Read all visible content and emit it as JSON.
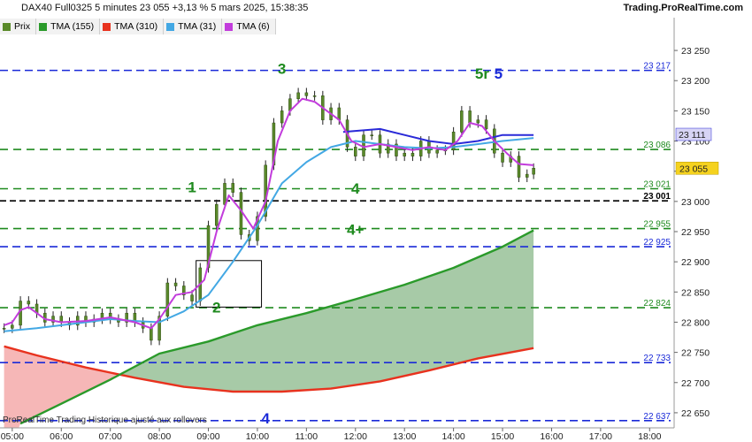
{
  "header": {
    "title": "DAX40 Full0325 5 minutes 23 055 +3,13 % 5 mars 2025, 15:38:35",
    "brand": "Trading.ProRealTime.com"
  },
  "legend": [
    {
      "label": "Prix",
      "color": "#5a8a2a"
    },
    {
      "label": "TMA (155)",
      "color": "#2a9a2a"
    },
    {
      "label": "TMA (310)",
      "color": "#e8321e"
    },
    {
      "label": "TMA (31)",
      "color": "#43a8e4"
    },
    {
      "label": "TMA (6)",
      "color": "#c23cdc"
    }
  ],
  "footer": "ProRealTime Trading  Historique ajusté aux rollovers",
  "chart_data": {
    "type": "line",
    "x_ticks": [
      "05:00",
      "06:00",
      "07:00",
      "08:00",
      "09:00",
      "10:00",
      "11:00",
      "12:00",
      "13:00",
      "14:00",
      "15:00",
      "16:00",
      "17:00",
      "18:00"
    ],
    "y_ticks": [
      22650,
      22700,
      22750,
      22800,
      22850,
      22900,
      22950,
      23000,
      23050,
      23100,
      23150,
      23200,
      23250
    ],
    "y_tick_labels": [
      "22 650",
      "22 700",
      "22 750",
      "22 800",
      "22 850",
      "22 900",
      "22 950",
      "23 000",
      "23 050",
      "23 100",
      "23 150",
      "23 200",
      "23 250"
    ],
    "ylim": [
      22625,
      23275
    ],
    "xlim": [
      "04:45",
      "18:30"
    ],
    "last_price": {
      "value": 23055,
      "label": "23 055",
      "color": "#f5d21e"
    },
    "levels": [
      {
        "value": 23217,
        "label": "23 217",
        "style": "dashed",
        "color": "#1a2ad8"
      },
      {
        "value": 23086,
        "label": "23 086",
        "style": "dashed",
        "color": "#1e8a1e"
      },
      {
        "value": 23021,
        "label": "23 021",
        "style": "dashed",
        "color": "#1e8a1e"
      },
      {
        "value": 23001,
        "label": "23 001",
        "style": "dashed",
        "color": "#000000"
      },
      {
        "value": 22955,
        "label": "22 955",
        "style": "dashed",
        "color": "#1e8a1e"
      },
      {
        "value": 22925,
        "label": "22 925",
        "style": "dashed",
        "color": "#1a2ad8"
      },
      {
        "value": 22824,
        "label": "22 824",
        "style": "dashed",
        "color": "#1e8a1e"
      },
      {
        "value": 22733,
        "label": "22 733",
        "style": "dashed",
        "color": "#1a2ad8"
      },
      {
        "value": 22637,
        "label": "22 637",
        "style": "dashed",
        "color": "#1a2ad8"
      }
    ],
    "tma31_tag": {
      "value": 23111,
      "label": "23 111"
    },
    "wave_labels": [
      {
        "text": "3",
        "time": "10:30",
        "value": 23220,
        "color": "#1e8a1e"
      },
      {
        "text": "5r",
        "time": "14:35",
        "value": 23212,
        "color": "#1e8a1e"
      },
      {
        "text": "5",
        "time": "14:55",
        "value": 23212,
        "color": "#1a2ad8"
      },
      {
        "text": "1",
        "time": "08:40",
        "value": 23024,
        "color": "#1e8a1e"
      },
      {
        "text": "4",
        "time": "12:00",
        "value": 23022,
        "color": "#1e8a1e"
      },
      {
        "text": "4+",
        "time": "12:00",
        "value": 22954,
        "color": "#1e8a1e"
      },
      {
        "text": "2",
        "time": "09:10",
        "value": 22825,
        "color": "#1e8a1e"
      },
      {
        "text": "4",
        "time": "10:10",
        "value": 22641,
        "color": "#1a2ad8"
      }
    ],
    "zone_box": {
      "t0": "08:45",
      "t1": "10:05",
      "v_top": 22902,
      "v_bottom": 22825
    },
    "series": [
      {
        "name": "Prix",
        "type": "candle-line",
        "color": "#5a8a2a",
        "points": [
          [
            "04:50",
            22790
          ],
          [
            "05:00",
            22795
          ],
          [
            "05:10",
            22835
          ],
          [
            "05:20",
            22830
          ],
          [
            "05:30",
            22815
          ],
          [
            "05:40",
            22800
          ],
          [
            "05:50",
            22810
          ],
          [
            "06:00",
            22800
          ],
          [
            "06:10",
            22795
          ],
          [
            "06:20",
            22810
          ],
          [
            "06:30",
            22800
          ],
          [
            "06:40",
            22805
          ],
          [
            "06:50",
            22815
          ],
          [
            "07:00",
            22805
          ],
          [
            "07:10",
            22800
          ],
          [
            "07:20",
            22815
          ],
          [
            "07:30",
            22800
          ],
          [
            "07:40",
            22790
          ],
          [
            "07:50",
            22770
          ],
          [
            "08:00",
            22810
          ],
          [
            "08:10",
            22865
          ],
          [
            "08:20",
            22860
          ],
          [
            "08:30",
            22845
          ],
          [
            "08:40",
            22835
          ],
          [
            "08:50",
            22890
          ],
          [
            "09:00",
            22960
          ],
          [
            "09:10",
            22995
          ],
          [
            "09:20",
            23030
          ],
          [
            "09:30",
            23015
          ],
          [
            "09:40",
            22945
          ],
          [
            "09:50",
            22935
          ],
          [
            "10:00",
            22975
          ],
          [
            "10:10",
            23060
          ],
          [
            "10:20",
            23130
          ],
          [
            "10:30",
            23150
          ],
          [
            "10:40",
            23170
          ],
          [
            "10:50",
            23180
          ],
          [
            "11:00",
            23175
          ],
          [
            "11:10",
            23175
          ],
          [
            "11:20",
            23135
          ],
          [
            "11:30",
            23155
          ],
          [
            "11:40",
            23135
          ],
          [
            "11:50",
            23090
          ],
          [
            "12:00",
            23075
          ],
          [
            "12:10",
            23110
          ],
          [
            "12:20",
            23110
          ],
          [
            "12:30",
            23080
          ],
          [
            "12:40",
            23095
          ],
          [
            "12:50",
            23075
          ],
          [
            "13:00",
            23080
          ],
          [
            "13:10",
            23075
          ],
          [
            "13:20",
            23100
          ],
          [
            "13:30",
            23080
          ],
          [
            "13:40",
            23085
          ],
          [
            "13:50",
            23085
          ],
          [
            "14:00",
            23115
          ],
          [
            "14:10",
            23150
          ],
          [
            "14:20",
            23130
          ],
          [
            "14:30",
            23135
          ],
          [
            "14:40",
            23120
          ],
          [
            "14:50",
            23080
          ],
          [
            "15:00",
            23065
          ],
          [
            "15:10",
            23075
          ],
          [
            "15:20",
            23040
          ],
          [
            "15:30",
            23045
          ],
          [
            "15:38",
            23055
          ]
        ]
      },
      {
        "name": "TMA (6)",
        "color": "#c23cdc",
        "points": [
          [
            "04:50",
            22795
          ],
          [
            "05:00",
            22800
          ],
          [
            "05:10",
            22820
          ],
          [
            "05:20",
            22825
          ],
          [
            "05:30",
            22815
          ],
          [
            "05:40",
            22805
          ],
          [
            "06:00",
            22800
          ],
          [
            "06:30",
            22802
          ],
          [
            "07:00",
            22808
          ],
          [
            "07:30",
            22800
          ],
          [
            "07:50",
            22790
          ],
          [
            "08:00",
            22805
          ],
          [
            "08:20",
            22845
          ],
          [
            "08:40",
            22850
          ],
          [
            "08:55",
            22870
          ],
          [
            "09:10",
            22950
          ],
          [
            "09:25",
            23010
          ],
          [
            "09:40",
            22985
          ],
          [
            "09:55",
            22955
          ],
          [
            "10:10",
            23000
          ],
          [
            "10:25",
            23100
          ],
          [
            "10:40",
            23150
          ],
          [
            "10:55",
            23170
          ],
          [
            "11:10",
            23165
          ],
          [
            "11:25",
            23150
          ],
          [
            "11:40",
            23135
          ],
          [
            "11:55",
            23100
          ],
          [
            "12:10",
            23090
          ],
          [
            "12:30",
            23095
          ],
          [
            "12:50",
            23090
          ],
          [
            "13:10",
            23085
          ],
          [
            "13:30",
            23090
          ],
          [
            "13:50",
            23085
          ],
          [
            "14:05",
            23100
          ],
          [
            "14:20",
            23130
          ],
          [
            "14:35",
            23125
          ],
          [
            "14:50",
            23100
          ],
          [
            "15:05",
            23080
          ],
          [
            "15:20",
            23062
          ],
          [
            "15:38",
            23060
          ]
        ]
      },
      {
        "name": "TMA (31)",
        "color": "#43a8e4",
        "points": [
          [
            "04:50",
            22785
          ],
          [
            "05:30",
            22790
          ],
          [
            "06:00",
            22795
          ],
          [
            "06:30",
            22800
          ],
          [
            "07:00",
            22805
          ],
          [
            "07:30",
            22802
          ],
          [
            "08:00",
            22800
          ],
          [
            "08:30",
            22818
          ],
          [
            "09:00",
            22845
          ],
          [
            "09:30",
            22900
          ],
          [
            "10:00",
            22960
          ],
          [
            "10:30",
            23030
          ],
          [
            "11:00",
            23065
          ],
          [
            "11:30",
            23090
          ],
          [
            "12:00",
            23100
          ],
          [
            "12:30",
            23095
          ],
          [
            "13:00",
            23090
          ],
          [
            "13:30",
            23088
          ],
          [
            "14:00",
            23090
          ],
          [
            "14:30",
            23095
          ],
          [
            "15:00",
            23100
          ],
          [
            "15:38",
            23105
          ]
        ]
      },
      {
        "name": "TMA (31) dark",
        "color": "#2a2ad8",
        "points": [
          [
            "11:45",
            23115
          ],
          [
            "12:30",
            23120
          ],
          [
            "13:00",
            23110
          ],
          [
            "13:30",
            23100
          ],
          [
            "14:00",
            23095
          ],
          [
            "14:30",
            23100
          ],
          [
            "15:00",
            23110
          ],
          [
            "15:38",
            23110
          ]
        ]
      },
      {
        "name": "TMA (155)",
        "color": "#2a9a2a",
        "points": [
          [
            "05:10",
            22632
          ],
          [
            "06:00",
            22665
          ],
          [
            "07:00",
            22705
          ],
          [
            "08:00",
            22748
          ],
          [
            "09:00",
            22768
          ],
          [
            "10:00",
            22795
          ],
          [
            "11:00",
            22815
          ],
          [
            "12:00",
            22838
          ],
          [
            "13:00",
            22862
          ],
          [
            "14:00",
            22890
          ],
          [
            "15:00",
            22925
          ],
          [
            "15:38",
            22952
          ]
        ]
      },
      {
        "name": "TMA (310)",
        "color": "#e8321e",
        "points": [
          [
            "04:50",
            22760
          ],
          [
            "05:30",
            22745
          ],
          [
            "06:30",
            22725
          ],
          [
            "07:30",
            22708
          ],
          [
            "08:30",
            22693
          ],
          [
            "09:30",
            22685
          ],
          [
            "10:30",
            22685
          ],
          [
            "11:30",
            22690
          ],
          [
            "12:30",
            22702
          ],
          [
            "13:30",
            22720
          ],
          [
            "14:30",
            22740
          ],
          [
            "15:38",
            22757
          ]
        ]
      }
    ]
  }
}
